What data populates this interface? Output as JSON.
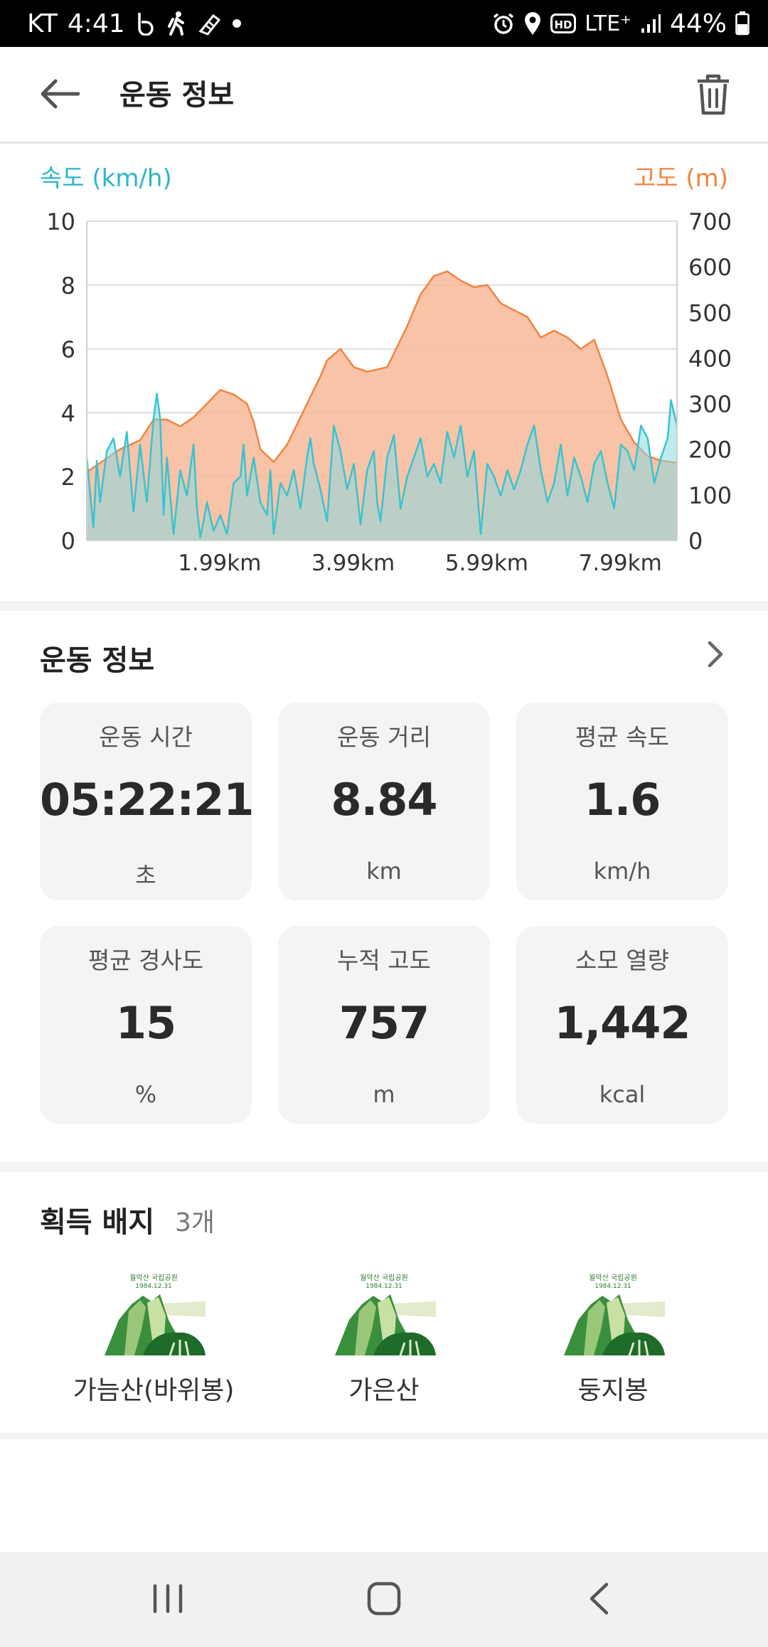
{
  "status_bar": {
    "carrier": "KT",
    "time": "4:41",
    "network": "LTE⁺",
    "battery": "44%"
  },
  "header": {
    "title": "운동 정보"
  },
  "chart_data": {
    "type": "area",
    "left_axis_label": "속도 (km/h)",
    "right_axis_label": "고도 (m)",
    "left_ylim": [
      0,
      10
    ],
    "right_ylim": [
      0,
      700
    ],
    "left_ticks": [
      "10",
      "8",
      "6",
      "4",
      "2",
      "0"
    ],
    "right_ticks": [
      "700",
      "600",
      "500",
      "400",
      "300",
      "200",
      "100",
      "0"
    ],
    "x_ticks": [
      "1.99km",
      "3.99km",
      "5.99km",
      "7.99km"
    ],
    "xlim_km": [
      0,
      8.84
    ],
    "grid": true,
    "series": [
      {
        "name": "고도 (m)",
        "axis": "right",
        "color": "#f7b896",
        "line_color": "#ef8542",
        "x_km": [
          0,
          0.2,
          0.5,
          0.8,
          1.0,
          1.2,
          1.4,
          1.6,
          1.8,
          2.0,
          2.2,
          2.4,
          2.5,
          2.6,
          2.8,
          3.0,
          3.2,
          3.4,
          3.5,
          3.6,
          3.8,
          4.0,
          4.2,
          4.5,
          4.8,
          5.0,
          5.2,
          5.4,
          5.6,
          5.8,
          6.0,
          6.2,
          6.4,
          6.6,
          6.8,
          7.0,
          7.2,
          7.4,
          7.6,
          7.8,
          8.0,
          8.2,
          8.4,
          8.6,
          8.84
        ],
        "values": [
          150,
          170,
          200,
          220,
          265,
          265,
          250,
          270,
          300,
          330,
          320,
          300,
          260,
          200,
          172,
          210,
          270,
          330,
          360,
          395,
          420,
          380,
          370,
          380,
          470,
          540,
          580,
          590,
          570,
          555,
          560,
          520,
          505,
          490,
          445,
          460,
          445,
          420,
          440,
          360,
          265,
          215,
          185,
          175,
          170
        ]
      },
      {
        "name": "속도 (km/h)",
        "axis": "left",
        "color": "#8ad8e0",
        "line_color": "#38c3d2",
        "x_km": [
          0,
          0.1,
          0.15,
          0.2,
          0.3,
          0.4,
          0.5,
          0.6,
          0.7,
          0.8,
          0.9,
          1.0,
          1.05,
          1.1,
          1.15,
          1.2,
          1.3,
          1.4,
          1.5,
          1.6,
          1.65,
          1.7,
          1.75,
          1.8,
          1.9,
          2.0,
          2.1,
          2.2,
          2.3,
          2.35,
          2.4,
          2.5,
          2.6,
          2.7,
          2.75,
          2.8,
          2.9,
          3.0,
          3.1,
          3.2,
          3.3,
          3.35,
          3.4,
          3.5,
          3.6,
          3.7,
          3.8,
          3.9,
          4.0,
          4.1,
          4.2,
          4.3,
          4.35,
          4.4,
          4.5,
          4.6,
          4.7,
          4.8,
          4.9,
          5.0,
          5.1,
          5.2,
          5.3,
          5.4,
          5.5,
          5.6,
          5.7,
          5.8,
          5.9,
          6.0,
          6.1,
          6.2,
          6.3,
          6.4,
          6.5,
          6.6,
          6.7,
          6.8,
          6.9,
          7.0,
          7.1,
          7.2,
          7.3,
          7.4,
          7.5,
          7.6,
          7.7,
          7.8,
          7.9,
          8.0,
          8.1,
          8.2,
          8.3,
          8.4,
          8.5,
          8.6,
          8.7,
          8.75,
          8.84
        ],
        "values": [
          2.6,
          0.4,
          2.5,
          1.2,
          2.8,
          3.2,
          2.0,
          3.4,
          0.9,
          3.0,
          1.2,
          3.8,
          4.6,
          3.8,
          0.8,
          2.6,
          0.2,
          2.2,
          1.4,
          3.0,
          1.0,
          0.1,
          0.6,
          1.2,
          0.3,
          0.8,
          0.2,
          1.8,
          2.0,
          3.0,
          1.4,
          2.6,
          1.2,
          0.8,
          2.2,
          0.2,
          1.8,
          1.4,
          2.2,
          1.0,
          2.6,
          3.2,
          2.4,
          1.6,
          0.6,
          3.6,
          2.8,
          1.6,
          2.4,
          0.5,
          2.2,
          2.8,
          1.2,
          0.6,
          2.6,
          3.3,
          1.0,
          2.0,
          2.6,
          3.2,
          2.0,
          2.4,
          1.8,
          3.4,
          2.6,
          3.6,
          2.0,
          2.8,
          0.2,
          2.4,
          2.0,
          1.4,
          2.2,
          1.6,
          2.2,
          3.0,
          3.6,
          2.2,
          1.2,
          1.8,
          3.0,
          1.4,
          2.6,
          2.0,
          1.2,
          2.4,
          2.8,
          1.8,
          1.0,
          3.0,
          2.8,
          2.2,
          3.6,
          3.2,
          1.8,
          2.6,
          3.2,
          4.4,
          3.6
        ]
      }
    ]
  },
  "workout": {
    "section_title": "운동 정보",
    "cards": [
      {
        "label": "운동 시간",
        "value": "05:22:21",
        "unit": "초"
      },
      {
        "label": "운동 거리",
        "value": "8.84",
        "unit": "km"
      },
      {
        "label": "평균 속도",
        "value": "1.6",
        "unit": "km/h"
      },
      {
        "label": "평균 경사도",
        "value": "15",
        "unit": "%"
      },
      {
        "label": "누적 고도",
        "value": "757",
        "unit": "m"
      },
      {
        "label": "소모 열량",
        "value": "1,442",
        "unit": "kcal"
      }
    ]
  },
  "badges": {
    "title": "획득 배지",
    "count": "3개",
    "items": [
      {
        "name": "가늠산(바위봉)",
        "emblem_text": "월악산 국립공원",
        "emblem_date": "1984.12.31"
      },
      {
        "name": "가은산",
        "emblem_text": "월악산 국립공원",
        "emblem_date": "1984.12.31"
      },
      {
        "name": "둥지봉",
        "emblem_text": "월악산 국립공원",
        "emblem_date": "1984.12.31"
      }
    ]
  },
  "icons": {
    "back": "arrow-left-icon",
    "delete": "trash-icon",
    "more": "chevron-right-icon",
    "nav_recents": "recents-icon",
    "nav_home": "home-icon",
    "nav_back": "nav-back-icon"
  },
  "colors": {
    "speed": "#38c3d2",
    "altitude": "#ef8542",
    "card_bg": "#f4f4f4"
  }
}
